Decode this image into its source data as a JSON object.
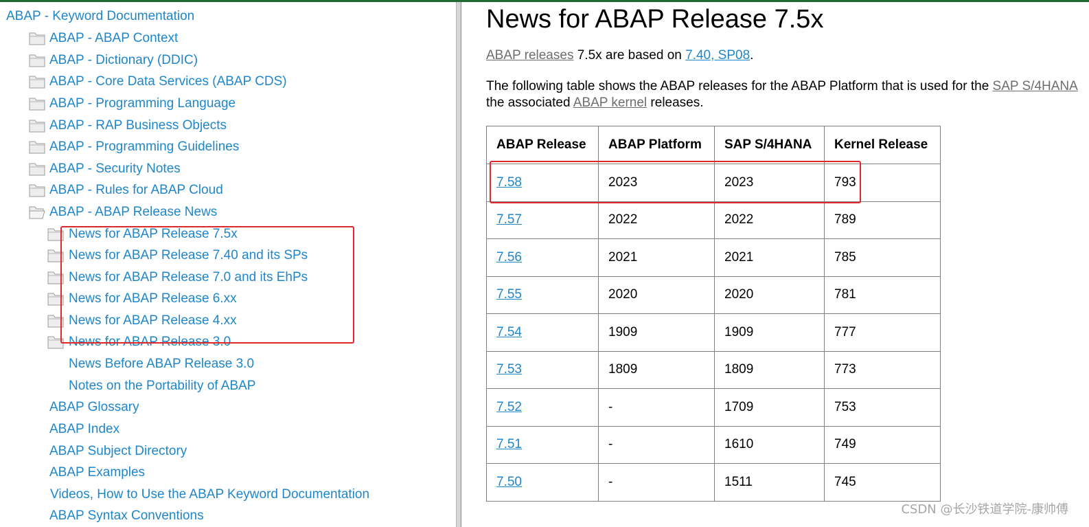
{
  "nav": {
    "root": "ABAP - Keyword Documentation",
    "level1": [
      "ABAP - ABAP Context",
      "ABAP - Dictionary (DDIC)",
      "ABAP - Core Data Services (ABAP CDS)",
      "ABAP - Programming Language",
      "ABAP - RAP Business Objects",
      "ABAP - Programming Guidelines",
      "ABAP - Security Notes",
      "ABAP - Rules for ABAP Cloud",
      "ABAP - ABAP Release News"
    ],
    "release_news_children": [
      "News for ABAP Release 7.5x",
      "News for ABAP Release 7.40 and its SPs",
      "News for ABAP Release 7.0 and its EhPs",
      "News for ABAP Release 6.xx",
      "News for ABAP Release 4.xx",
      "News for ABAP Release 3.0",
      "News Before ABAP Release 3.0",
      "Notes on the Portability of ABAP"
    ],
    "bottom_items": [
      "ABAP Glossary",
      "ABAP Index",
      "ABAP Subject Directory",
      "ABAP Examples",
      "Videos, How to Use the ABAP Keyword Documentation",
      "ABAP Syntax Conventions"
    ]
  },
  "content": {
    "title": "News for ABAP Release 7.5x",
    "intro": {
      "link1": "ABAP releases",
      "text1": " 7.5x are based on ",
      "link2": "7.40, SP08",
      "text2": "."
    },
    "para2": {
      "text1": "The following table shows the ABAP releases for the ABAP Platform that is used for the ",
      "link1": "SAP S/4HANA",
      "text2": "the associated ",
      "link2": "ABAP kernel",
      "text3": " releases."
    },
    "table": {
      "headers": [
        "ABAP Release",
        "ABAP Platform",
        "SAP S/4HANA",
        "Kernel Release"
      ],
      "rows": [
        [
          "7.58",
          "2023",
          "2023",
          "793"
        ],
        [
          "7.57",
          "2022",
          "2022",
          "789"
        ],
        [
          "7.56",
          "2021",
          "2021",
          "785"
        ],
        [
          "7.55",
          "2020",
          "2020",
          "781"
        ],
        [
          "7.54",
          "1909",
          "1909",
          "777"
        ],
        [
          "7.53",
          "1809",
          "1809",
          "773"
        ],
        [
          "7.52",
          "-",
          "1709",
          "753"
        ],
        [
          "7.51",
          "-",
          "1610",
          "749"
        ],
        [
          "7.50",
          "-",
          "1511",
          "745"
        ]
      ]
    }
  },
  "watermark": "CSDN @长沙铁道学院-康帅傅",
  "colors": {
    "link": "#1f86c9",
    "highlight": "#e0282c",
    "topbar": "#1e6b34"
  },
  "icons": {
    "closed": "folder-icon",
    "open": "folder-open-icon"
  }
}
